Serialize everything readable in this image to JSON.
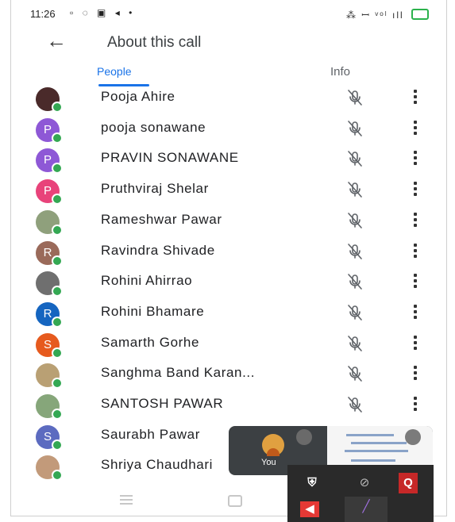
{
  "status": {
    "time": "11:26",
    "left_icons": "▫ ◌ ▣ ◂ •",
    "right_icons": "⁂ ꟷ ᵛᵒˡ ıll"
  },
  "appbar": {
    "back_icon": "arrow-left-icon",
    "title": "About this call"
  },
  "tabs": [
    {
      "label": "People",
      "active": true
    },
    {
      "label": "Info",
      "active": false
    }
  ],
  "participants": [
    {
      "name": "Pooja Ahire",
      "initial": "",
      "avatar_color": "#4a2a2a"
    },
    {
      "name": "pooja sonawane",
      "initial": "P",
      "avatar_color": "#8e58d6"
    },
    {
      "name": "PRAVIN SONAWANE",
      "initial": "P",
      "avatar_color": "#8e58d6"
    },
    {
      "name": "Pruthviraj Shelar",
      "initial": "P",
      "avatar_color": "#e8437a"
    },
    {
      "name": "Rameshwar Pawar",
      "initial": "",
      "avatar_color": "#8fa07c"
    },
    {
      "name": "Ravindra Shivade",
      "initial": "R",
      "avatar_color": "#9a6a5a"
    },
    {
      "name": "Rohini Ahirrao",
      "initial": "",
      "avatar_color": "#6f6f6f"
    },
    {
      "name": "Rohini Bhamare",
      "initial": "R",
      "avatar_color": "#1565c0"
    },
    {
      "name": "Samarth Gorhe",
      "initial": "S",
      "avatar_color": "#e65a1e"
    },
    {
      "name": "Sanghma Band Karan...",
      "initial": "",
      "avatar_color": "#b9a074"
    },
    {
      "name": "SANTOSH PAWAR",
      "initial": "",
      "avatar_color": "#86a67a"
    },
    {
      "name": "Saurabh Pawar",
      "initial": "S",
      "avatar_color": "#5c6bc0"
    },
    {
      "name": "Shriya Chaudhari",
      "initial": "",
      "avatar_color": "#c29a7a"
    }
  ],
  "pip": {
    "self_label": "You"
  },
  "overlay": {
    "btn1_label": "",
    "btn3_label": "Q"
  },
  "colors": {
    "accent": "#1a73e8",
    "online": "#34a853"
  }
}
